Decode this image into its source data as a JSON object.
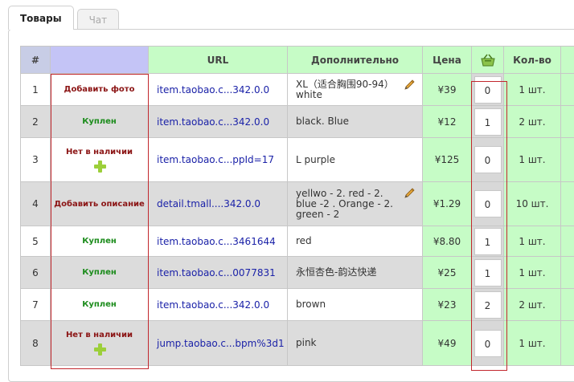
{
  "tabs": [
    {
      "label": "Товары",
      "active": true
    },
    {
      "label": "Чат",
      "active": false
    }
  ],
  "table": {
    "columns": {
      "hash": "#",
      "status": "",
      "url": "URL",
      "extra": "Дополнительно",
      "price": "Цена",
      "cart": "cart-icon",
      "count": "Кол-во"
    },
    "rows": [
      {
        "num": "1",
        "status": "Добавить фото",
        "status_color": "red",
        "plus": false,
        "url": "item.taobao.c...342.0.0",
        "extra": "XL（适合胸围90-94） white",
        "pencil": true,
        "price": "¥39",
        "qty": "0",
        "count": "1 шт."
      },
      {
        "num": "2",
        "status": "Куплен",
        "status_color": "green",
        "plus": false,
        "url": "item.taobao.c...342.0.0",
        "extra": "black. Blue",
        "pencil": false,
        "price": "¥12",
        "qty": "1",
        "count": "2 шт."
      },
      {
        "num": "3",
        "status": "Нет в наличии",
        "status_color": "red",
        "plus": true,
        "url": "item.taobao.c...ppId=17",
        "extra": "L purple",
        "pencil": false,
        "price": "¥125",
        "qty": "0",
        "count": "1 шт."
      },
      {
        "num": "4",
        "status": "Добавить описание",
        "status_color": "red",
        "plus": false,
        "url": "detail.tmall....342.0.0",
        "extra": "yellwo - 2. red - 2. blue -2 . Orange - 2. green - 2",
        "pencil": true,
        "price": "¥1.29",
        "qty": "0",
        "count": "10 шт."
      },
      {
        "num": "5",
        "status": "Куплен",
        "status_color": "green",
        "plus": false,
        "url": "item.taobao.c...3461644",
        "extra": "red",
        "pencil": false,
        "price": "¥8.80",
        "qty": "1",
        "count": "1 шт."
      },
      {
        "num": "6",
        "status": "Куплен",
        "status_color": "green",
        "plus": false,
        "url": "item.taobao.c...0077831",
        "extra": "永恒杏色-韵达快递",
        "pencil": false,
        "price": "¥25",
        "qty": "1",
        "count": "1 шт."
      },
      {
        "num": "7",
        "status": "Куплен",
        "status_color": "green",
        "plus": false,
        "url": "item.taobao.c...342.0.0",
        "extra": "brown",
        "pencil": false,
        "price": "¥23",
        "qty": "2",
        "count": "2 шт."
      },
      {
        "num": "8",
        "status": "Нет в наличии",
        "status_color": "red",
        "plus": true,
        "url": "jump.taobao.c...bpm%3d1",
        "extra": "pink",
        "pencil": false,
        "price": "¥49",
        "qty": "0",
        "count": "1 шт."
      }
    ]
  },
  "colors": {
    "header_green": "#c6fcc6",
    "header_blue": "#c4c4f6",
    "header_hash": "#c8cde6",
    "link": "#1b22a8",
    "status_red": "#8b1414",
    "status_green": "#1c8c1c",
    "highlight_box": "#c2272d"
  }
}
